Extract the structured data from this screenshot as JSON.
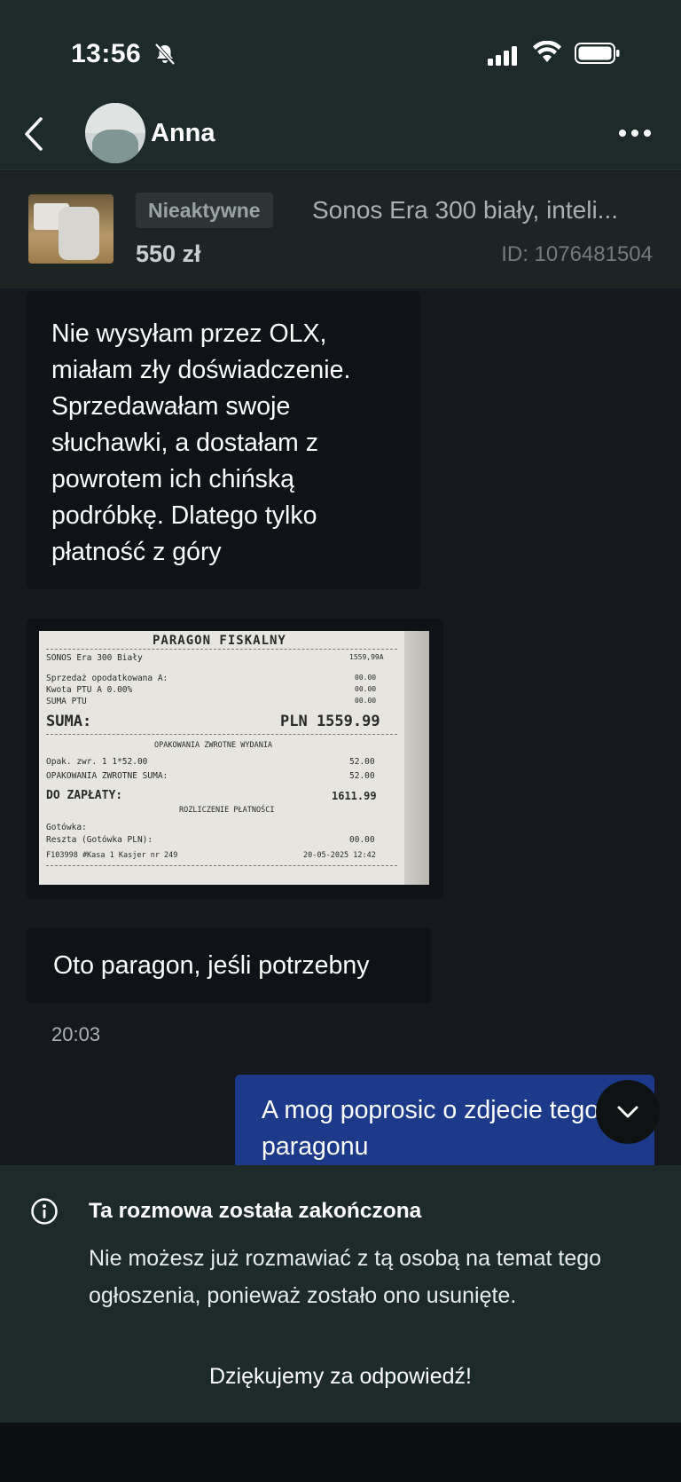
{
  "status_bar": {
    "time": "13:56",
    "icons": [
      "bell-off-icon",
      "signal-icon",
      "wifi-icon",
      "battery-icon"
    ]
  },
  "header": {
    "contact_name": "Anna",
    "back_icon": "chevron-left-icon",
    "more_icon": "more-horizontal-icon"
  },
  "listing": {
    "status_badge": "Nieaktywne",
    "title": "Sonos Era 300 biały, inteli...",
    "price": "550 zł",
    "id": "ID: 1076481504"
  },
  "messages": [
    {
      "direction": "incoming",
      "text": "Nie wysyłam przez OLX, miałam zły doświadczenie. Sprzedawałam swoje słuchawki, a dostałam z powrotem ich chińską podróbkę. Dlatego tylko płatność z góry"
    },
    {
      "direction": "incoming",
      "type": "image",
      "receipt": {
        "header": "PARAGON FISKALNY",
        "lines": [
          {
            "left": "SONOS Era 300 Biały",
            "right": "1559,99A"
          },
          {
            "left": "Sprzedaż opodatkowana A:",
            "right": "00.00"
          },
          {
            "left": "Kwota PTU A 0.00%",
            "right": "00.00"
          },
          {
            "left": "SUMA PTU",
            "right": "00.00"
          }
        ],
        "suma_label": "SUMA:",
        "suma_value": "PLN 1559.99",
        "opak_header": "OPAKOWANIA ZWROTNE WYDANIA",
        "opak_lines": [
          {
            "left": "Opak. zwr. 1 1*52.00",
            "right": "52.00"
          },
          {
            "left": "OPAKOWANIA ZWROTNE SUMA:",
            "right": "52.00"
          }
        ],
        "do_zaplaty_label": "DO ZAPŁATY:",
        "do_zaplaty_value": "1611.99",
        "rozliczenie": "ROZLICZENIE PŁATNOŚCI",
        "payment_lines": [
          {
            "left": "Gotówka:",
            "right": ""
          },
          {
            "left": "Reszta (Gotówka PLN):",
            "right": "00.00"
          },
          {
            "left": "F103998 #Kasa 1 Kasjer nr 249",
            "right": "20-05-2025 12:42"
          }
        ]
      }
    },
    {
      "direction": "incoming",
      "text": "Oto paragon, jeśli potrzebny"
    },
    {
      "direction": "outgoing",
      "text": "A mog poprosic o zdjecie tego paragonu"
    }
  ],
  "last_incoming_time": "20:03",
  "ended": {
    "title": "Ta rozmowa została zakończona",
    "description": "Nie możesz już rozmawiać z tą osobą na temat tego ogłoszenia, ponieważ zostało ono usunięte.",
    "thanks": "Dziękujemy za odpowiedź!"
  },
  "colors": {
    "header_bg": "#1c2a2a",
    "chat_bg": "#15191f",
    "incoming_bubble": "#0f1217",
    "outgoing_bubble": "#1d3a8a"
  }
}
